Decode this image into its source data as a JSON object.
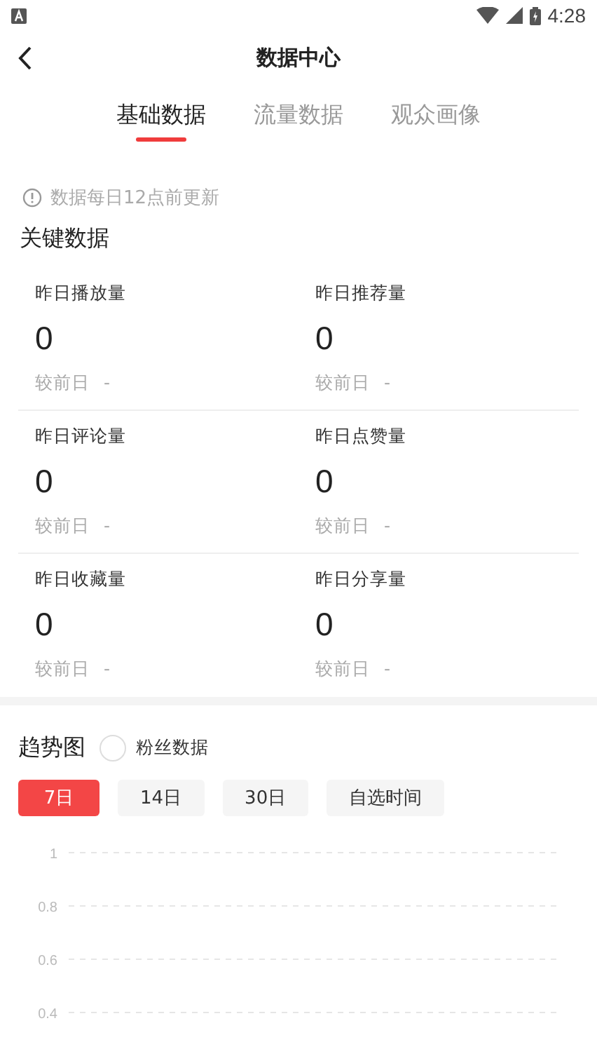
{
  "status_bar": {
    "time": "4:28"
  },
  "header": {
    "title": "数据中心"
  },
  "tabs": [
    {
      "label": "基础数据",
      "selected": true
    },
    {
      "label": "流量数据",
      "selected": false
    },
    {
      "label": "观众画像",
      "selected": false
    }
  ],
  "notice": "数据每日12点前更新",
  "key_data": {
    "title": "关键数据",
    "metrics": [
      {
        "label": "昨日播放量",
        "value": "0",
        "compare_label": "较前日",
        "compare_value": "-"
      },
      {
        "label": "昨日推荐量",
        "value": "0",
        "compare_label": "较前日",
        "compare_value": "-"
      },
      {
        "label": "昨日评论量",
        "value": "0",
        "compare_label": "较前日",
        "compare_value": "-"
      },
      {
        "label": "昨日点赞量",
        "value": "0",
        "compare_label": "较前日",
        "compare_value": "-"
      },
      {
        "label": "昨日收藏量",
        "value": "0",
        "compare_label": "较前日",
        "compare_value": "-"
      },
      {
        "label": "昨日分享量",
        "value": "0",
        "compare_label": "较前日",
        "compare_value": "-"
      }
    ]
  },
  "trend": {
    "title": "趋势图",
    "fans_toggle": {
      "label": "粉丝数据",
      "checked": false
    },
    "ranges": [
      {
        "label": "7日",
        "selected": true
      },
      {
        "label": "14日",
        "selected": false
      },
      {
        "label": "30日",
        "selected": false
      },
      {
        "label": "自选时间",
        "selected": false
      }
    ],
    "chart_axis_labels": [
      "1",
      "0.8",
      "0.6",
      "0.4"
    ]
  }
}
